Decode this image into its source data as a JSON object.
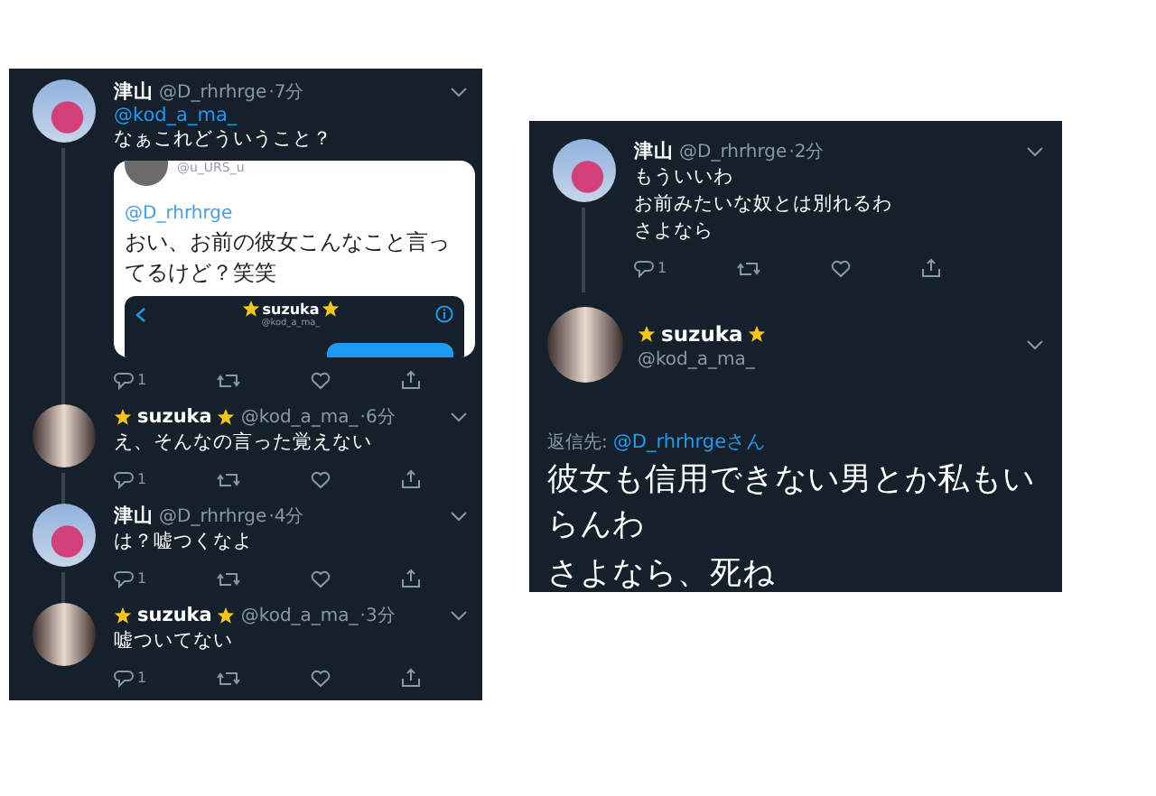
{
  "left_thread": {
    "tweets": [
      {
        "kind": "landscape",
        "name": "津山",
        "star_badges": false,
        "handle": "@D_rhrhrge",
        "time": "·7分",
        "mention": "@kod_a_ma_",
        "text": [
          "なぁこれどういうこと？"
        ],
        "reply_count": "1",
        "thread_below": true,
        "quote": {
          "handle": "@u_URS_u",
          "mention": "@D_rhrhrge",
          "text": "おい、お前の彼女こんなこと言ってるけど？笑笑",
          "embedded": {
            "name": "suzuka",
            "handle": "@kod_a_ma_"
          }
        }
      },
      {
        "kind": "portrait",
        "name": "suzuka",
        "star_badges": true,
        "handle": "@kod_a_ma_",
        "time": "·6分",
        "text": [
          "え、そんなの言った覚えない"
        ],
        "reply_count": "1",
        "thread_below": true
      },
      {
        "kind": "landscape",
        "name": "津山",
        "star_badges": false,
        "handle": "@D_rhrhrge",
        "time": "·4分",
        "text": [
          "は？嘘つくなよ"
        ],
        "reply_count": "1",
        "thread_below": true
      },
      {
        "kind": "portrait",
        "name": "suzuka",
        "star_badges": true,
        "handle": "@kod_a_ma_",
        "time": "·3分",
        "text": [
          "嘘ついてない"
        ],
        "reply_count": "1",
        "thread_below": false
      }
    ]
  },
  "right_thread": {
    "tweets": [
      {
        "kind": "landscape",
        "name": "津山",
        "star_badges": false,
        "handle": "@D_rhrhrge",
        "time": "·2分",
        "text": [
          "もういいわ",
          "お前みたいな奴とは別れるわ",
          "さよなら"
        ],
        "reply_count": "1",
        "thread_below": true
      }
    ],
    "focused": {
      "kind": "portrait",
      "name": "suzuka",
      "star_badges": true,
      "handle": "@kod_a_ma_",
      "reply_to_label": "返信先:",
      "reply_to": "@D_rhrhrgeさん",
      "text": [
        "彼女も信用できない男とか私もいらんわ",
        "さよなら、死ね"
      ]
    }
  }
}
